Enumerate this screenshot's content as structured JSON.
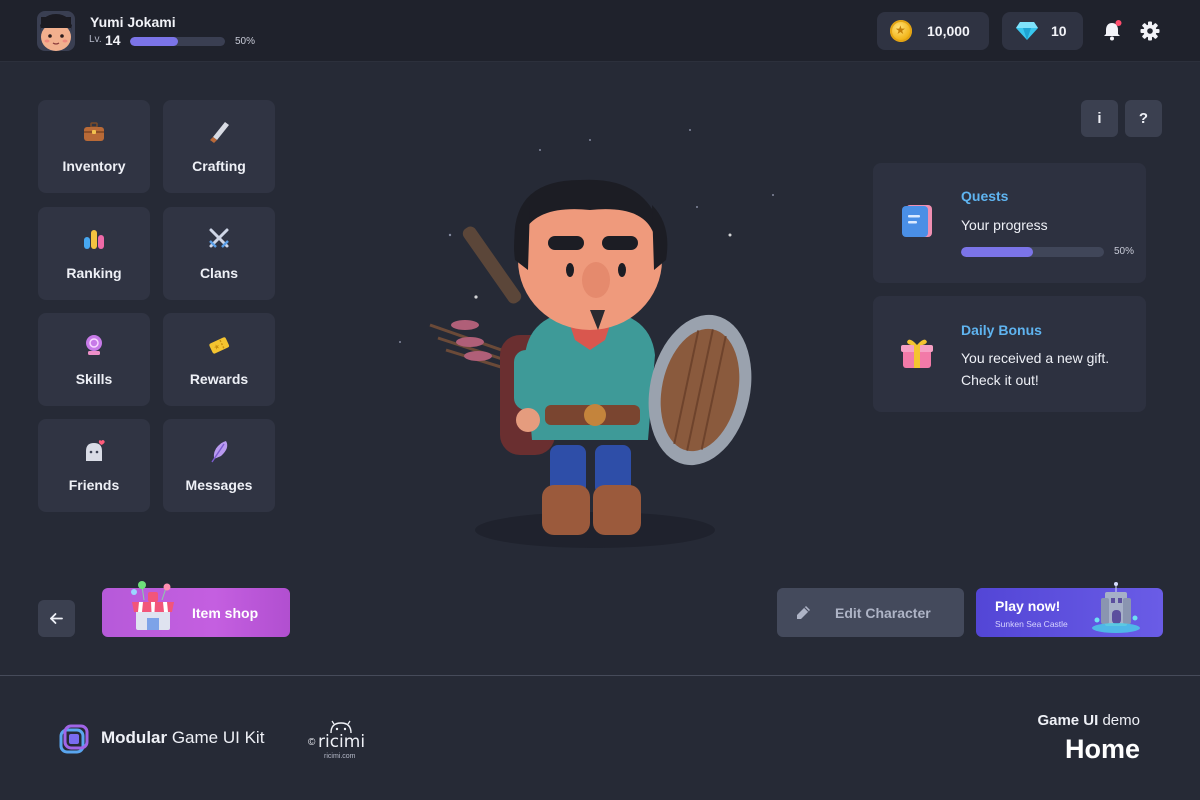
{
  "player": {
    "name": "Yumi Jokami",
    "level_label": "Lv.",
    "level": "14",
    "xp_percent_text": "50%",
    "xp_fraction": 0.5
  },
  "currency": {
    "coins": "10,000",
    "gems": "10"
  },
  "menu": {
    "items": [
      {
        "label": "Inventory",
        "icon": "briefcase-icon"
      },
      {
        "label": "Crafting",
        "icon": "saw-icon"
      },
      {
        "label": "Ranking",
        "icon": "ranking-bars-icon"
      },
      {
        "label": "Clans",
        "icon": "crossed-swords-icon"
      },
      {
        "label": "Skills",
        "icon": "crystal-ball-icon"
      },
      {
        "label": "Rewards",
        "icon": "ticket-icon"
      },
      {
        "label": "Friends",
        "icon": "ghost-heart-icon"
      },
      {
        "label": "Messages",
        "icon": "feather-icon"
      }
    ]
  },
  "help": {
    "info_label": "i",
    "help_label": "?"
  },
  "quests": {
    "title": "Quests",
    "subtitle": "Your progress",
    "progress_text": "50%",
    "progress_fraction": 0.5
  },
  "daily_bonus": {
    "title": "Daily Bonus",
    "line1": "You received a new gift.",
    "line2": "Check it out!"
  },
  "actions": {
    "item_shop": "Item shop",
    "edit_character": "Edit Character",
    "play_now": "Play now!",
    "play_subtitle": "Sunken Sea Castle"
  },
  "footer": {
    "brand_bold": "Modular",
    "brand_rest": " Game UI Kit",
    "ricimi_name": "ricimi",
    "ricimi_url": "ricimi.com",
    "demo_bold": "Game UI",
    "demo_rest": " demo",
    "page_name": "Home"
  },
  "colors": {
    "background": "#262a36",
    "topbar": "#1f222c",
    "tile": "#303443",
    "accent_progress": "#7b74e8",
    "card_title": "#5fb4f0",
    "shop_button": "#c45fe0",
    "play_button": "#5b4fe0"
  }
}
